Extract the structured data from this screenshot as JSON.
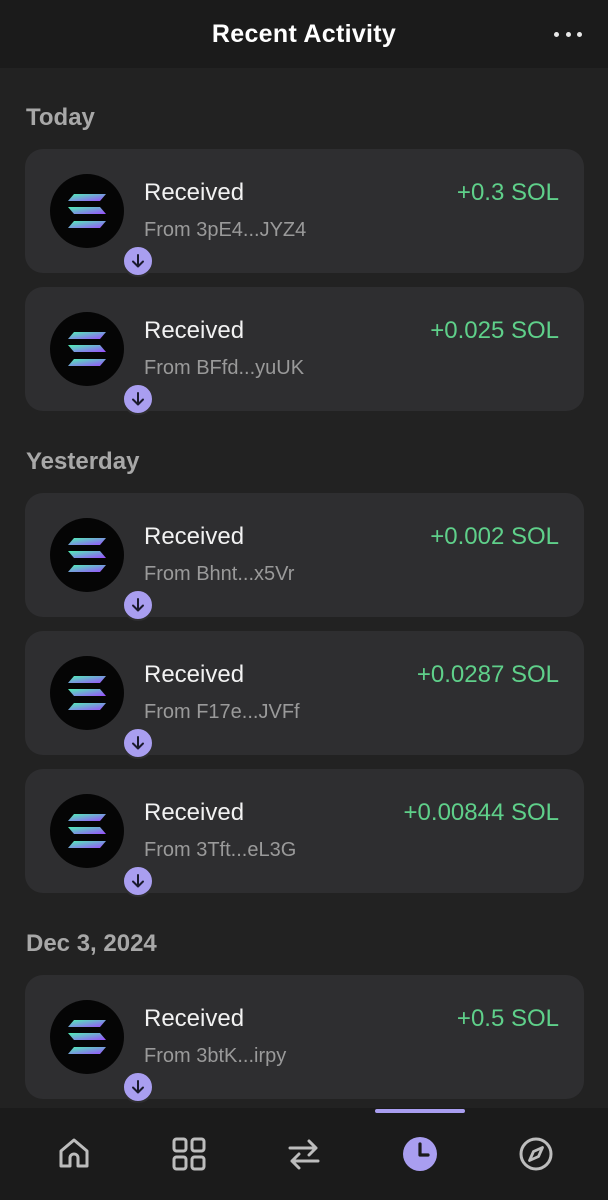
{
  "header": {
    "title": "Recent Activity",
    "more_icon": "more-horizontal-icon"
  },
  "sections": [
    {
      "title": "Today",
      "items": [
        {
          "label": "Received",
          "from": "From 3pE4...JYZ4",
          "amount": "+0.3 SOL"
        },
        {
          "label": "Received",
          "from": "From BFfd...yuUK",
          "amount": "+0.025 SOL"
        }
      ]
    },
    {
      "title": "Yesterday",
      "items": [
        {
          "label": "Received",
          "from": "From Bhnt...x5Vr",
          "amount": "+0.002 SOL"
        },
        {
          "label": "Received",
          "from": "From F17e...JVFf",
          "amount": "+0.0287 SOL"
        },
        {
          "label": "Received",
          "from": "From 3Tft...eL3G",
          "amount": "+0.00844 SOL"
        }
      ]
    },
    {
      "title": "Dec 3, 2024",
      "items": [
        {
          "label": "Received",
          "from": "From 3btK...irpy",
          "amount": "+0.5 SOL"
        }
      ]
    }
  ],
  "tabs": [
    {
      "icon": "home-icon",
      "active": false
    },
    {
      "icon": "grid-icon",
      "active": false
    },
    {
      "icon": "swap-icon",
      "active": false
    },
    {
      "icon": "clock-icon",
      "active": true
    },
    {
      "icon": "compass-icon",
      "active": false
    }
  ],
  "colors": {
    "background": "#222222",
    "card": "#2e2e30",
    "accent": "#a99ef0",
    "positive": "#5fd08a",
    "muted_text": "#9a9a9a"
  }
}
